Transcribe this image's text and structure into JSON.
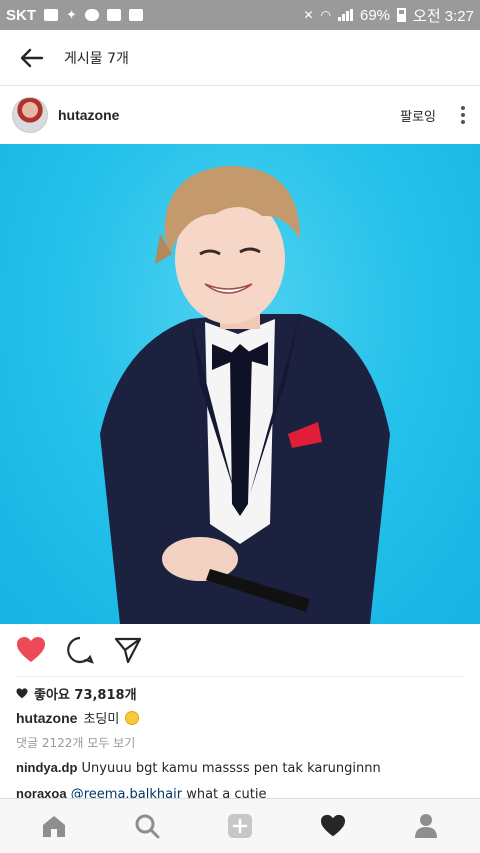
{
  "status_bar": {
    "carrier": "SKT",
    "battery": "69%",
    "time": "오전 3:27"
  },
  "header": {
    "title": "게시물 7개",
    "back_icon": "back-arrow-icon"
  },
  "post": {
    "username": "hutazone",
    "follow_label": "팔로잉",
    "photo_description_colors": {
      "background": "#22c0ea",
      "suit": "#1c2140",
      "pocket_square": "#e01e37"
    }
  },
  "actions": {
    "like_icon": "heart-filled-icon",
    "comment_icon": "comment-icon",
    "share_icon": "share-icon",
    "like_color": "#ed4956"
  },
  "likes": {
    "label": "좋아요 73,818개"
  },
  "caption": {
    "username": "hutazone",
    "text": "초딩미"
  },
  "comments": {
    "view_all": "댓글 2122개 모두 보기",
    "items": [
      {
        "username": "nindya.dp",
        "text": "Unyuuu bgt kamu massss pen tak karunginnn"
      },
      {
        "username": "noraxoa",
        "mention": "@reema.balkhair",
        "text": "what a cutie"
      }
    ]
  },
  "bottom_nav": {
    "items": [
      "home-icon",
      "search-icon",
      "add-icon",
      "activity-heart-icon",
      "profile-icon"
    ]
  }
}
